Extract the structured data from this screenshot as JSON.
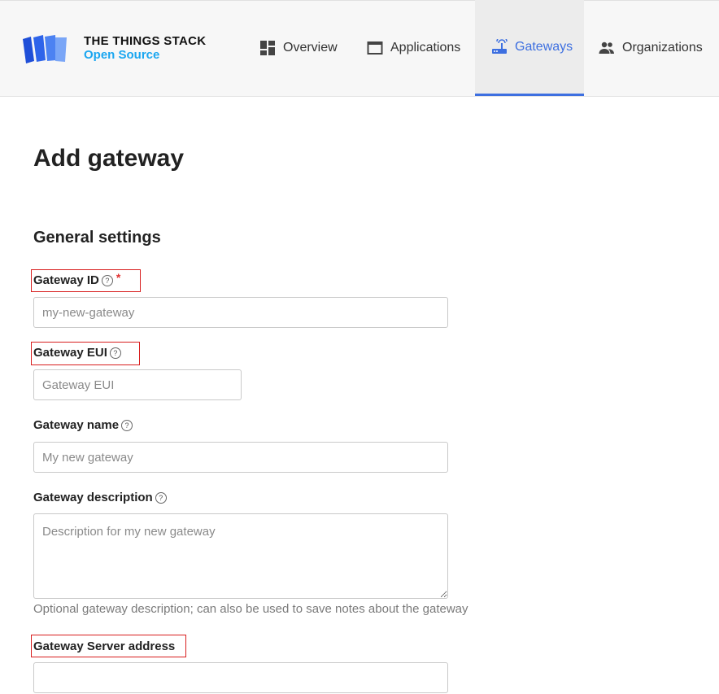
{
  "brand": {
    "line1": "THE THINGS STACK",
    "line2": "Open Source",
    "accent": "#3d6fe0",
    "brand_blue": "#1aa6f0"
  },
  "nav": {
    "items": [
      {
        "label": "Overview",
        "icon": "dashboard-icon"
      },
      {
        "label": "Applications",
        "icon": "window-icon"
      },
      {
        "label": "Gateways",
        "icon": "router-icon",
        "active": true
      },
      {
        "label": "Organizations",
        "icon": "people-icon"
      }
    ]
  },
  "page": {
    "title": "Add gateway",
    "section": "General settings"
  },
  "form": {
    "gateway_id": {
      "label": "Gateway ID",
      "required_mark": "*",
      "placeholder": "my-new-gateway",
      "value": ""
    },
    "gateway_eui": {
      "label": "Gateway EUI",
      "placeholder": "Gateway EUI",
      "value": ""
    },
    "gateway_name": {
      "label": "Gateway name",
      "placeholder": "My new gateway",
      "value": ""
    },
    "gateway_description": {
      "label": "Gateway description",
      "placeholder": "Description for my new gateway",
      "hint": "Optional gateway description; can also be used to save notes about the gateway"
    },
    "gateway_server_address": {
      "label": "Gateway Server address",
      "value": ""
    }
  },
  "icons": {
    "help": "?"
  }
}
